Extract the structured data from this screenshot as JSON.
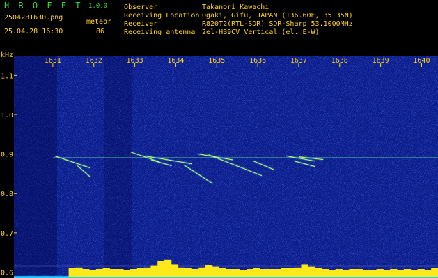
{
  "app": {
    "title": "H R O F F T",
    "version": "1.0.0"
  },
  "file": {
    "name": "2504281630.png",
    "datetime": "25.04.28 16:30"
  },
  "event": {
    "label": "meteor",
    "count": "86"
  },
  "meta": [
    {
      "key": "Observer",
      "value": "Takanori Kawachi"
    },
    {
      "key": "Receiving Location",
      "value": "Ogaki, Gifu, JAPAN (136.60E, 35.35N)"
    },
    {
      "key": "Receiver",
      "value": "R820T2(RTL-SDR) SDR-Sharp 53.1000MHz"
    },
    {
      "key": "Receiving antenna",
      "value": "2el-HB9CV Vertical (el. E-W)"
    }
  ],
  "colors": {
    "label": "#ffd21e",
    "title": "#3fd23f",
    "echo": "#e8ff40",
    "carrier": "#6cff9a"
  },
  "chart_data": {
    "type": "heatmap",
    "ylabel": "kHz",
    "x_ticks": [
      "1631",
      "1632",
      "1633",
      "1634",
      "1635",
      "1636",
      "1637",
      "1638",
      "1639",
      "1640"
    ],
    "y_ticks": [
      "1.1",
      "1.0",
      "0.9",
      "0.8",
      "0.7",
      "0.6"
    ],
    "xlim": [
      1630.05,
      1640.4
    ],
    "ylim": [
      0.585,
      1.15
    ],
    "carrier": {
      "freq_khz": 0.89,
      "start": 1631.0,
      "end": 1640.4
    },
    "echoes": [
      {
        "t0": 1631.05,
        "f0": 0.895,
        "t1": 1631.9,
        "f1": 0.865
      },
      {
        "t0": 1631.6,
        "f0": 0.87,
        "t1": 1631.9,
        "f1": 0.843
      },
      {
        "t0": 1632.9,
        "f0": 0.905,
        "t1": 1633.6,
        "f1": 0.88
      },
      {
        "t0": 1633.25,
        "f0": 0.895,
        "t1": 1634.4,
        "f1": 0.875
      },
      {
        "t0": 1633.4,
        "f0": 0.885,
        "t1": 1633.9,
        "f1": 0.87
      },
      {
        "t0": 1634.2,
        "f0": 0.872,
        "t1": 1634.9,
        "f1": 0.825
      },
      {
        "t0": 1634.55,
        "f0": 0.9,
        "t1": 1635.4,
        "f1": 0.885
      },
      {
        "t0": 1634.8,
        "f0": 0.898,
        "t1": 1636.1,
        "f1": 0.845
      },
      {
        "t0": 1635.9,
        "f0": 0.882,
        "t1": 1636.4,
        "f1": 0.86
      },
      {
        "t0": 1636.7,
        "f0": 0.895,
        "t1": 1637.4,
        "f1": 0.882
      },
      {
        "t0": 1637.0,
        "f0": 0.893,
        "t1": 1637.6,
        "f1": 0.886
      },
      {
        "t0": 1636.9,
        "f0": 0.882,
        "t1": 1637.4,
        "f1": 0.868
      }
    ],
    "signal_level": [
      0.05,
      0.05,
      0.06,
      0.05,
      0.06,
      0.05,
      0.06,
      0.05,
      0.55,
      0.6,
      0.5,
      0.45,
      0.5,
      0.55,
      0.5,
      0.5,
      0.45,
      0.5,
      0.55,
      0.6,
      0.7,
      1.0,
      1.1,
      0.8,
      0.6,
      0.55,
      0.5,
      0.6,
      0.75,
      0.65,
      0.55,
      0.5,
      0.5,
      0.45,
      0.5,
      0.55,
      0.5,
      0.5,
      0.5,
      0.55,
      0.55,
      0.6,
      0.8,
      0.65,
      0.55,
      0.5,
      0.45,
      0.5,
      0.45,
      0.5,
      0.5,
      0.45,
      0.45,
      0.5,
      0.45,
      0.5,
      0.45,
      0.5,
      0.45,
      0.5,
      0.45,
      0.55
    ]
  }
}
